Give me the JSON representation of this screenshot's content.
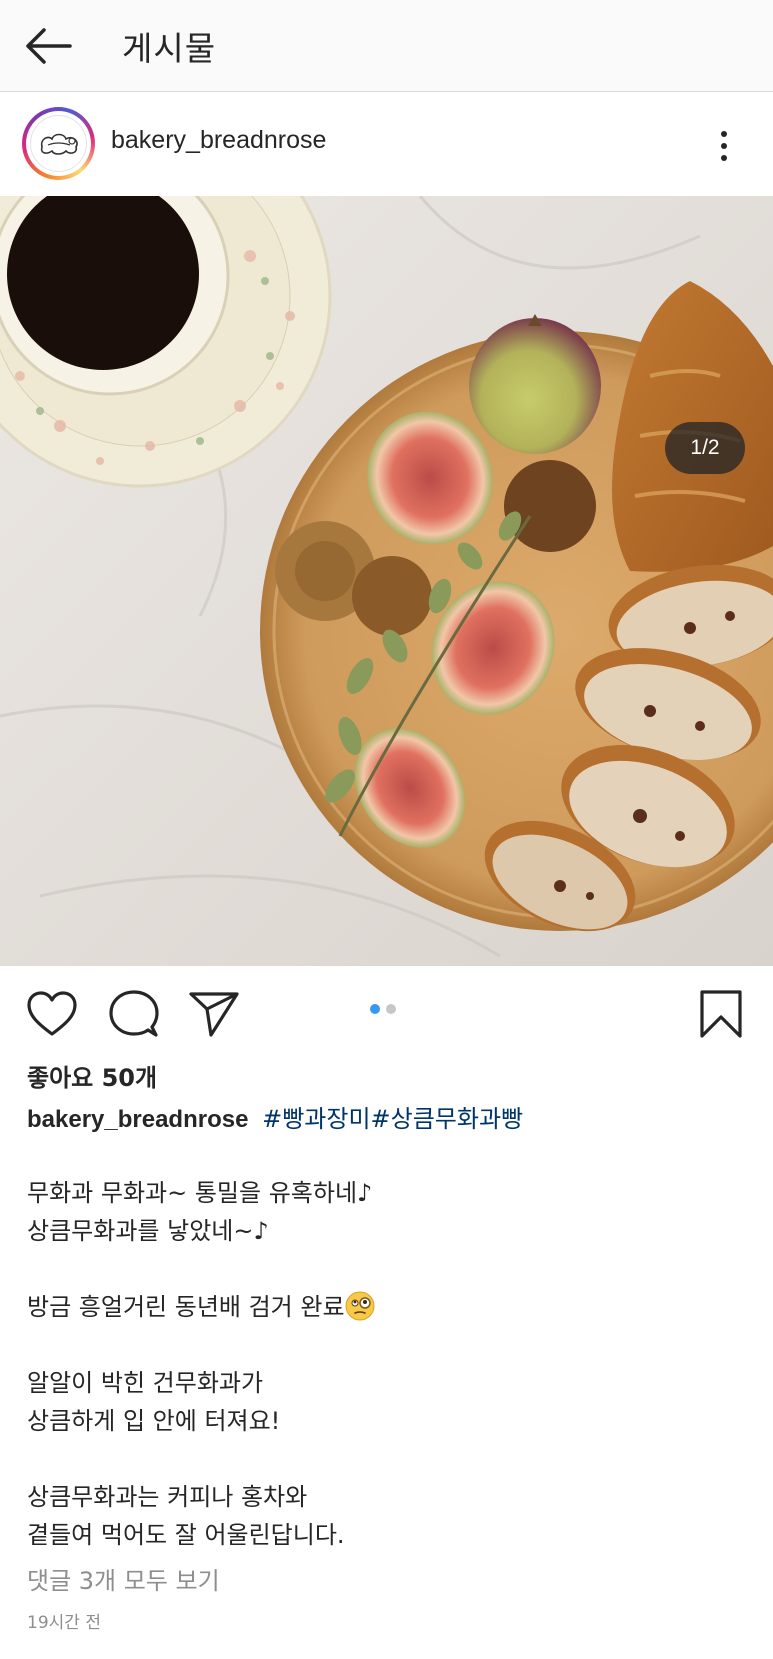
{
  "topbar": {
    "title": "게시물"
  },
  "post": {
    "username": "bakery_breadnrose",
    "image_counter": "1/2",
    "carousel": {
      "count": 2,
      "active_index": 0
    },
    "likes": "좋아요 50개",
    "caption": {
      "username": "bakery_breadnrose",
      "hashtags": [
        "#빵과장미",
        "#상큼무화과빵"
      ],
      "lines": [
        "무화과 무화과~ 통밀을 유혹하네♪",
        "상큼무화과를 낳았네~♪",
        "",
        "방금 흥얼거린 동년배 검거 완료",
        "",
        "알알이 박힌 건무화과가",
        "상큼하게 입 안에 터져요!",
        "",
        "상큼무화과는 커피나 홍차와",
        "곁들여 먹어도 잘 어울린답니다."
      ],
      "emoji": "face-with-rolling-eyes-monocle"
    },
    "view_comments": "댓글 3개 모두 보기",
    "timestamp": "19시간 전"
  },
  "icons": {
    "back": "arrow-left-icon",
    "more": "more-vertical-icon",
    "like": "heart-icon",
    "comment": "comment-icon",
    "share": "send-icon",
    "save": "bookmark-icon"
  },
  "colors": {
    "hashtag": "#003569",
    "carousel_active": "#3897f0",
    "muted_text": "#8e8e8e"
  }
}
